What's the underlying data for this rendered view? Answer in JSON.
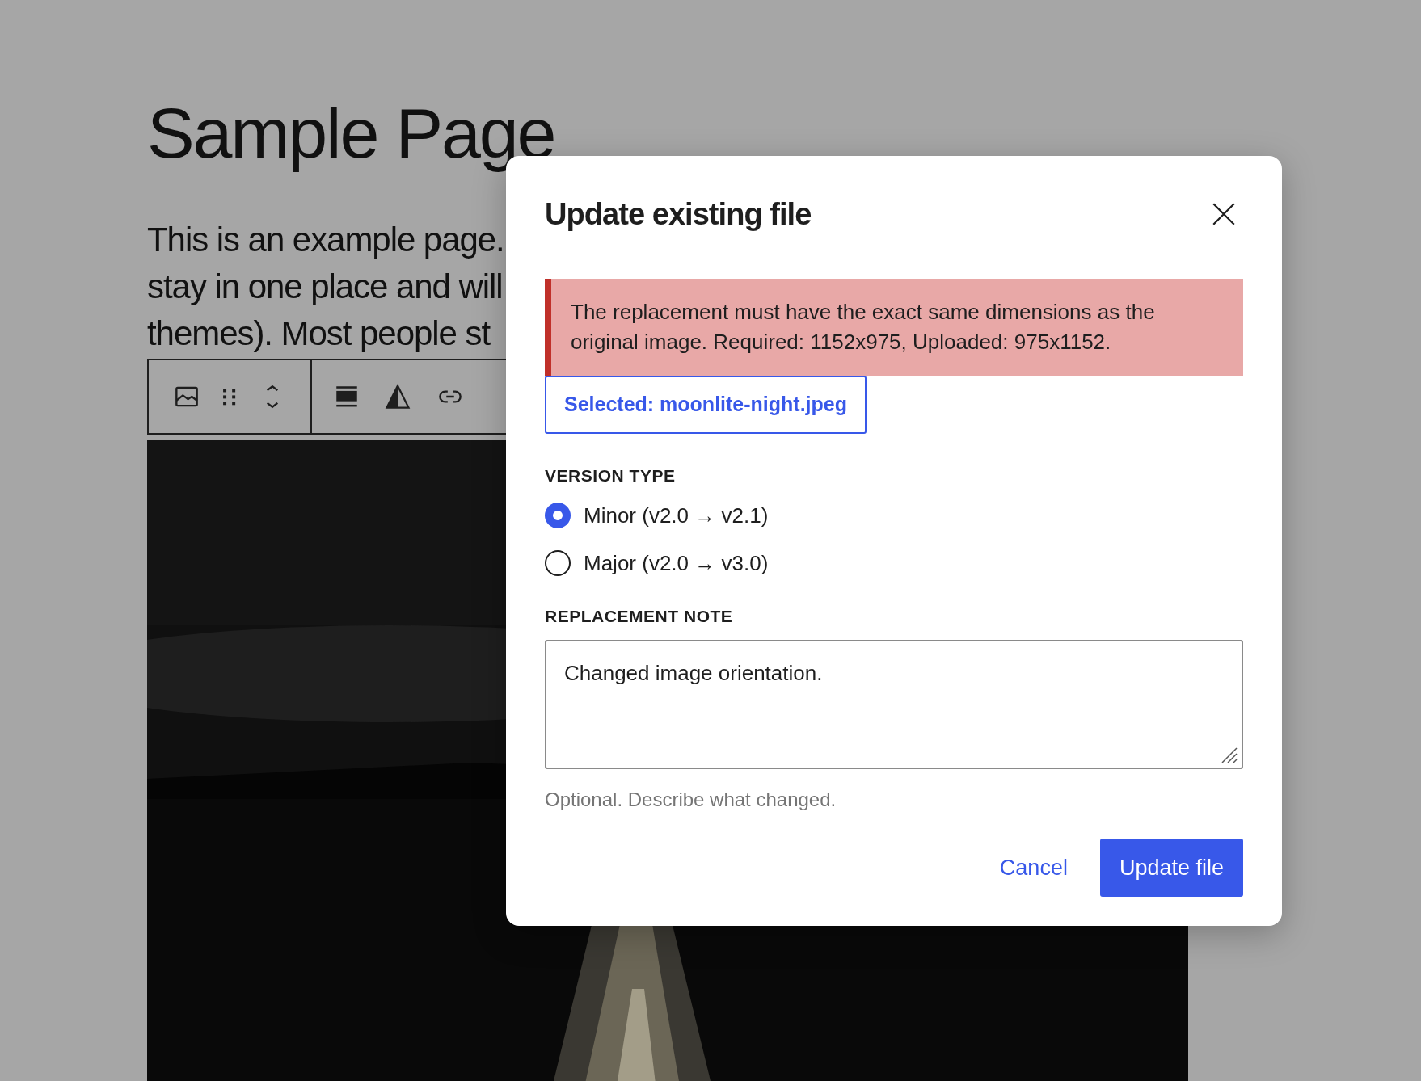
{
  "page": {
    "title": "Sample Page",
    "paragraph_lines": [
      "This is an example page.",
      "stay in one place and will",
      "themes). Most people st"
    ]
  },
  "dialog": {
    "title": "Update existing file",
    "error": "The replacement must have the exact same dimensions as the original image. Required: 1152x975, Uploaded: 975x1152.",
    "selected_file": "Selected: moonlite-night.jpeg",
    "version_type": {
      "label": "VERSION TYPE",
      "options": [
        {
          "label": "Minor (v2.0 → v2.1)",
          "selected": true
        },
        {
          "label": "Major (v2.0 → v3.0)",
          "selected": false
        }
      ]
    },
    "note": {
      "label": "REPLACEMENT NOTE",
      "value": "Changed image orientation.",
      "help": "Optional. Describe what changed."
    },
    "buttons": {
      "cancel": "Cancel",
      "confirm": "Update file"
    }
  }
}
